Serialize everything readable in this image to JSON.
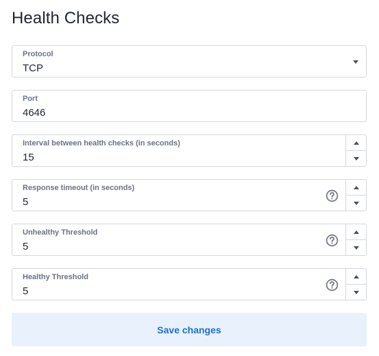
{
  "page": {
    "title": "Health Checks"
  },
  "fields": {
    "protocol": {
      "label": "Protocol",
      "value": "TCP"
    },
    "port": {
      "label": "Port",
      "value": "4646"
    },
    "interval": {
      "label": "Interval between health checks (in seconds)",
      "value": "15"
    },
    "timeout": {
      "label": "Response timeout (in seconds)",
      "value": "5"
    },
    "unhealthy": {
      "label": "Unhealthy Threshold",
      "value": "5"
    },
    "healthy": {
      "label": "Healthy Threshold",
      "value": "5"
    }
  },
  "actions": {
    "save_label": "Save changes"
  },
  "icons": {
    "dropdown": "chevron-down-icon",
    "stepper_up": "arrow-up-icon",
    "stepper_down": "arrow-down-icon",
    "help": "question-circle-icon"
  },
  "colors": {
    "accent": "#1f6fd1",
    "button_bg": "#e8f1fc",
    "border": "#d4d7de",
    "label": "#6b7184"
  }
}
